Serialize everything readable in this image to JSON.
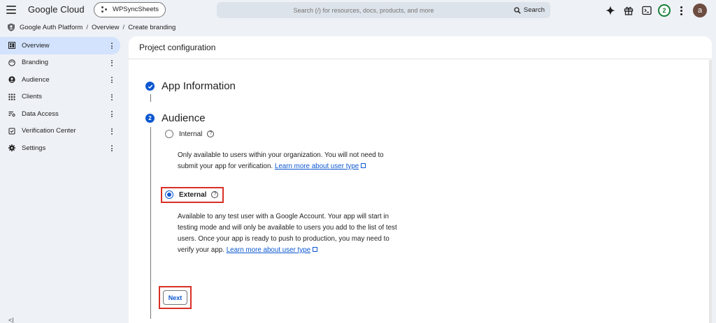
{
  "header": {
    "brand": "Google Cloud",
    "project": "WPSyncSheets",
    "search_placeholder": "Search (/) for resources, docs, products, and more",
    "search_button": "Search",
    "notifications_count": "2",
    "avatar_letter": "a"
  },
  "breadcrumb": {
    "root": "Google Auth Platform",
    "sep1": "/",
    "mid": "Overview",
    "sep2": "/",
    "current": "Create branding"
  },
  "sidebar": {
    "items": [
      {
        "label": "Overview",
        "icon": "dashboard-icon"
      },
      {
        "label": "Branding",
        "icon": "palette-icon"
      },
      {
        "label": "Audience",
        "icon": "person-icon"
      },
      {
        "label": "Clients",
        "icon": "grid-icon"
      },
      {
        "label": "Data Access",
        "icon": "filter-list-icon"
      },
      {
        "label": "Verification Center",
        "icon": "checklist-icon"
      },
      {
        "label": "Settings",
        "icon": "gear-icon"
      }
    ],
    "collapse_label": "<|"
  },
  "main": {
    "panel_title": "Project configuration",
    "step1_title": "App Information",
    "step2_number": "2",
    "step2_title": "Audience",
    "internal": {
      "label": "Internal",
      "desc": "Only available to users within your organization. You will not need to submit your app for verification.",
      "link": "Learn more about user type"
    },
    "external": {
      "label": "External",
      "desc": "Available to any test user with a Google Account. Your app will start in testing mode and will only be available to users you add to the list of test users. Once your app is ready to push to production, you may need to verify your app.",
      "link": "Learn more about user type"
    },
    "next_button": "Next",
    "help_glyph": "?"
  },
  "colors": {
    "accent": "#0b57d0",
    "highlight": "#d93025",
    "active_nav": "#d3e3fd"
  }
}
